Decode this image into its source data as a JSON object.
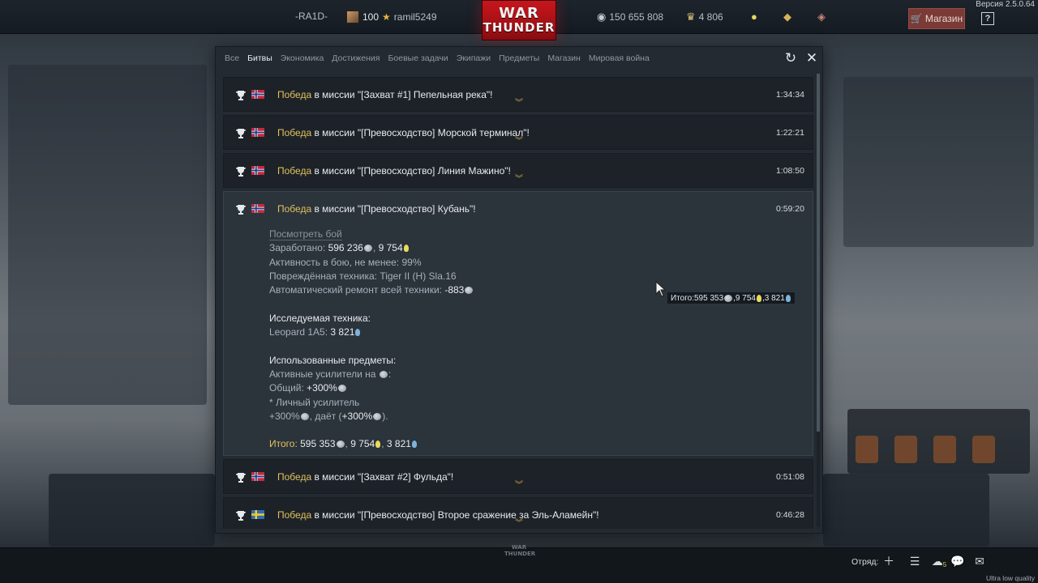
{
  "app": {
    "version": "Версия 2.5.0.64",
    "quality": "Ultra low quality"
  },
  "topbar": {
    "clan_tag": "-RA1D-",
    "rank_value": "100",
    "username": "ramil5249",
    "logo_line1": "WAR",
    "logo_line2": "THUNDER",
    "silver_lions": "150 655 808",
    "eagles": "4 806",
    "shop_label": "Магазин",
    "help_label": "?"
  },
  "tabs": [
    {
      "label": "Все",
      "active": false
    },
    {
      "label": "Битвы",
      "active": true
    },
    {
      "label": "Экономика",
      "active": false
    },
    {
      "label": "Достижения",
      "active": false
    },
    {
      "label": "Боевые задачи",
      "active": false
    },
    {
      "label": "Экипажи",
      "active": false
    },
    {
      "label": "Предметы",
      "active": false
    },
    {
      "label": "Магазин",
      "active": false
    },
    {
      "label": "Мировая война",
      "active": false
    }
  ],
  "battles": [
    {
      "victory": "Победа",
      "rest": " в миссии \"[Захват #1] Пепельная река\"!",
      "time": "1:34:34",
      "flag": "norway"
    },
    {
      "victory": "Победа",
      "rest": " в миссии \"[Превосходство] Морской терминал\"!",
      "time": "1:22:21",
      "flag": "norway"
    },
    {
      "victory": "Победа",
      "rest": " в миссии \"[Превосходство] Линия Мажино\"!",
      "time": "1:08:50",
      "flag": "norway"
    },
    {
      "victory": "Победа",
      "rest": " в миссии \"[Превосходство] Кубань\"!",
      "time": "0:59:20",
      "flag": "norway"
    },
    {
      "victory": "Победа",
      "rest": " в миссии \"[Захват #2] Фульда\"!",
      "time": "0:51:08",
      "flag": "norway"
    },
    {
      "victory": "Победа",
      "rest": " в миссии \"[Превосходство] Второе сражение за Эль-Аламейн\"!",
      "time": "0:46:28",
      "flag": "sweden"
    }
  ],
  "details": {
    "watch_battle": "Посмотреть бой",
    "earned_label": "Заработано: ",
    "earned_sl": "596 236",
    "earned_ge_sep": ", ",
    "earned_ge": "9 754",
    "activity": "Активность в бою, не менее: 99%",
    "damaged_label": "Повреждённая техника: ",
    "damaged_vehicle": "Tiger II (H) Sla.16",
    "repair_label": "Автоматический ремонт всей техники: ",
    "repair_value": "-883",
    "research_head": "Исследуемая техника:",
    "research_vehicle": "Leopard 1A5: ",
    "research_rp": "3 821",
    "items_head": "Использованные предметы:",
    "boosters_label": "Активные усилители на ",
    "boosters_colon": ":",
    "general_label": "Общий: ",
    "general_value": "+300%",
    "personal_label": "* Личный усилитель",
    "personal_value": "+300%",
    "gives_label": ", даёт (",
    "gives_value": "+300%",
    "gives_end": ").",
    "total_label": "Итого: ",
    "total_sl": "595 353",
    "total_sep1": ", ",
    "total_ge": "9 754",
    "total_sep2": ", ",
    "total_rp": "3 821"
  },
  "tooltip": {
    "label": "Итого: ",
    "sl": "595 353",
    "sep1": ", ",
    "ge": "9 754",
    "sep2": ", ",
    "rp": "3 821"
  },
  "bottombar": {
    "logo_line1": "WAR",
    "logo_line2": "THUNDER",
    "squad_label": "Отряд:",
    "friends_count": "5"
  },
  "colors": {
    "victory": "#e3c15d",
    "logo_red": "#c6161c",
    "shop_bg": "#7a3a36"
  },
  "icons": {
    "shop": "cart-icon",
    "help": "question-icon",
    "refresh": "refresh-icon",
    "close": "close-icon",
    "trophy": "trophy-icon",
    "chevron": "chevron-down-icon"
  }
}
